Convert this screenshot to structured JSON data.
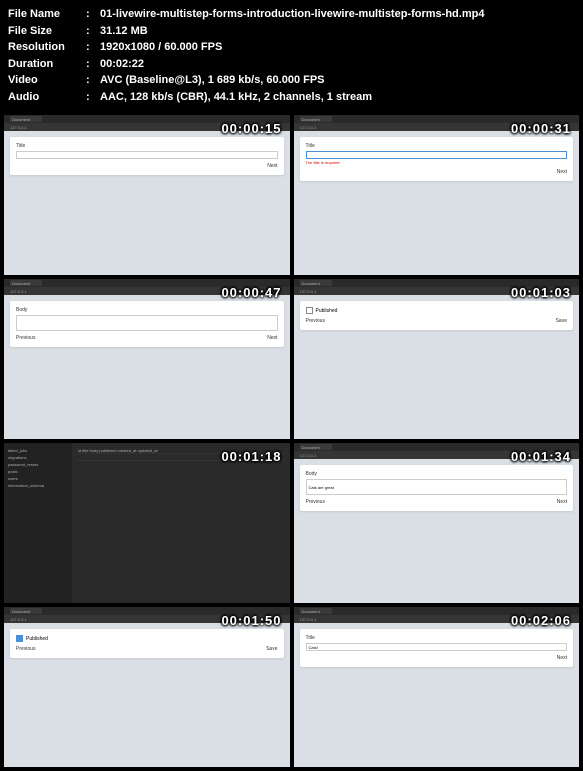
{
  "info": {
    "filename_label": "File Name",
    "filename_value": "01-livewire-multistep-forms-introduction-livewire-multistep-forms-hd.mp4",
    "filesize_label": "File Size",
    "filesize_value": "31.12 MB",
    "resolution_label": "Resolution",
    "resolution_value": "1920x1080 / 60.000 FPS",
    "duration_label": "Duration",
    "duration_value": "00:02:22",
    "video_label": "Video",
    "video_value": "AVC (Baseline@L3), 1 689 kb/s, 60.000 FPS",
    "audio_label": "Audio",
    "audio_value": "AAC, 128 kb/s (CBR), 44.1 kHz, 2 channels, 1 stream"
  },
  "thumbs": [
    {
      "time": "00:00:15",
      "title_label": "Title",
      "footer_right": "Next",
      "tab": "Document",
      "url": "127.0.0.1"
    },
    {
      "time": "00:00:31",
      "title_label": "Title",
      "error": "The title is required",
      "footer_right": "Next",
      "tab": "Document",
      "url": "127.0.0.1"
    },
    {
      "time": "00:00:47",
      "body_label": "Body",
      "footer_left": "Previous",
      "footer_right": "Next",
      "tab": "Document",
      "url": "127.0.0.1"
    },
    {
      "time": "00:01:03",
      "published_label": "Published",
      "footer_left": "Previous",
      "footer_right": "Save",
      "tab": "Document",
      "url": "127.0.0.1"
    },
    {
      "time": "00:01:18",
      "db_items": [
        "failed_jobs",
        "migrations",
        "password_resets",
        "posts",
        "users",
        "information_schema"
      ],
      "db_cols": "id  title  body  published  created_at  updated_at"
    },
    {
      "time": "00:01:34",
      "body_label": "Body",
      "body_value": "Cats are great",
      "footer_left": "Previous",
      "footer_right": "Next",
      "tab": "Document",
      "url": "127.0.0.1"
    },
    {
      "time": "00:01:50",
      "published_label": "Published",
      "checked": true,
      "footer_left": "Previous",
      "footer_right": "Save",
      "tab": "Document",
      "url": "127.0.0.1"
    },
    {
      "time": "00:02:06",
      "title_label": "Title",
      "title_value": "Cats!",
      "footer_right": "Next",
      "tab": "Document",
      "url": "127.0.0.1"
    }
  ]
}
